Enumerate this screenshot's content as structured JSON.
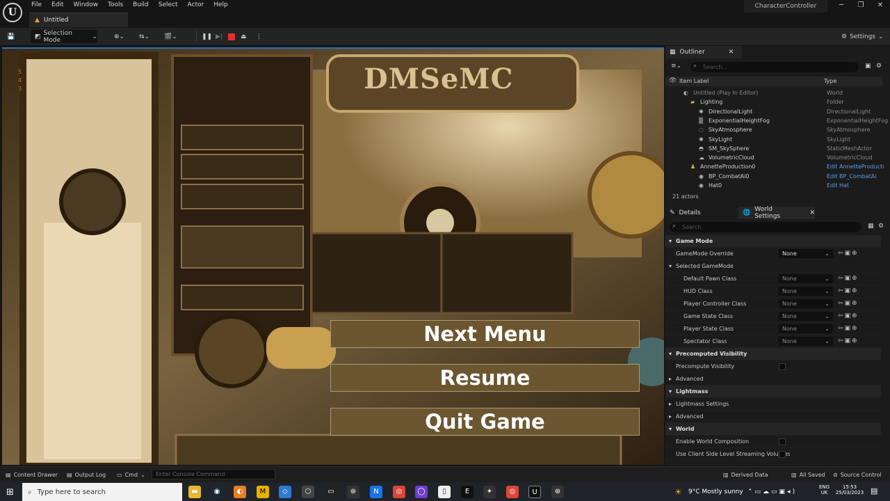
{
  "menu": [
    "File",
    "Edit",
    "Window",
    "Tools",
    "Build",
    "Select",
    "Actor",
    "Help"
  ],
  "document_tab": "Untitled",
  "project_name": "CharacterController",
  "toolbar": {
    "selection_mode": "Selection Mode",
    "settings": "Settings"
  },
  "game_menu": {
    "next": "Next Menu",
    "resume": "Resume",
    "quit": "Quit Game"
  },
  "viewport_stats": [
    "5",
    "4",
    "3"
  ],
  "viewport_art_text": "DMSeMC",
  "outliner": {
    "tab": "Outliner",
    "search_placeholder": "Search...",
    "col_label": "Item Label",
    "col_type": "Type",
    "rows": [
      {
        "label": "Untitled (Play In Editor)",
        "type": "World"
      },
      {
        "label": "Lighting",
        "type": "Folder"
      },
      {
        "label": "DirectionalLight",
        "type": "DirectionalLight"
      },
      {
        "label": "ExponentialHeightFog",
        "type": "ExponentialHeightFog"
      },
      {
        "label": "SkyAtmosphere",
        "type": "SkyAtmosphere"
      },
      {
        "label": "SkyLight",
        "type": "SkyLight"
      },
      {
        "label": "SM_SkySphere",
        "type": "StaticMeshActor"
      },
      {
        "label": "VolumetricCloud",
        "type": "VolumetricCloud"
      },
      {
        "label": "AnnetteProduction0",
        "type": "Edit AnnetteProducti"
      },
      {
        "label": "BP_CombatAi0",
        "type": "Edit BP_CombatAi"
      },
      {
        "label": "Hat0",
        "type": "Edit Hat"
      }
    ],
    "actor_count": "21 actors"
  },
  "details": {
    "tab_details": "Details",
    "tab_world": "World Settings",
    "search_placeholder": "Search",
    "rows": [
      {
        "kind": "cat",
        "label": "Game Mode"
      },
      {
        "kind": "dd",
        "label": "GameMode Override",
        "value": "None",
        "on": true
      },
      {
        "kind": "cat2",
        "label": "Selected GameMode"
      },
      {
        "kind": "dd",
        "label": "Default Pawn Class",
        "value": "None",
        "indent": true
      },
      {
        "kind": "dd",
        "label": "HUD Class",
        "value": "None",
        "indent": true
      },
      {
        "kind": "dd",
        "label": "Player Controller Class",
        "value": "None",
        "indent": true
      },
      {
        "kind": "dd",
        "label": "Game State Class",
        "value": "None",
        "indent": true
      },
      {
        "kind": "dd",
        "label": "Player State Class",
        "value": "None",
        "indent": true
      },
      {
        "kind": "dd",
        "label": "Spectator Class",
        "value": "None",
        "indent": true
      },
      {
        "kind": "cat",
        "label": "Precomputed Visibility"
      },
      {
        "kind": "chk",
        "label": "Precompute Visibility"
      },
      {
        "kind": "sub",
        "label": "Advanced"
      },
      {
        "kind": "cat",
        "label": "Lightmass"
      },
      {
        "kind": "sub",
        "label": "Lightmass Settings"
      },
      {
        "kind": "sub",
        "label": "Advanced"
      },
      {
        "kind": "cat",
        "label": "World"
      },
      {
        "kind": "chk",
        "label": "Enable World Composition"
      },
      {
        "kind": "chk",
        "label": "Use Client Side Level Streaming Volumes"
      }
    ]
  },
  "statusbar": {
    "content_drawer": "Content Drawer",
    "output_log": "Output Log",
    "cmd": "Cmd",
    "console_placeholder": "Enter Console Command",
    "derived_data": "Derived Data",
    "all_saved": "All Saved",
    "source_control": "Source Control"
  },
  "taskbar": {
    "search_placeholder": "Type here to search",
    "weather": "9°C  Mostly sunny",
    "lang_top": "ENG",
    "lang_bottom": "UK",
    "time": "15:53",
    "date": "25/03/2023"
  },
  "colors": {
    "accent": "#2d6fc2",
    "button_fill": "#6b5630",
    "link": "#5aa0e8"
  }
}
